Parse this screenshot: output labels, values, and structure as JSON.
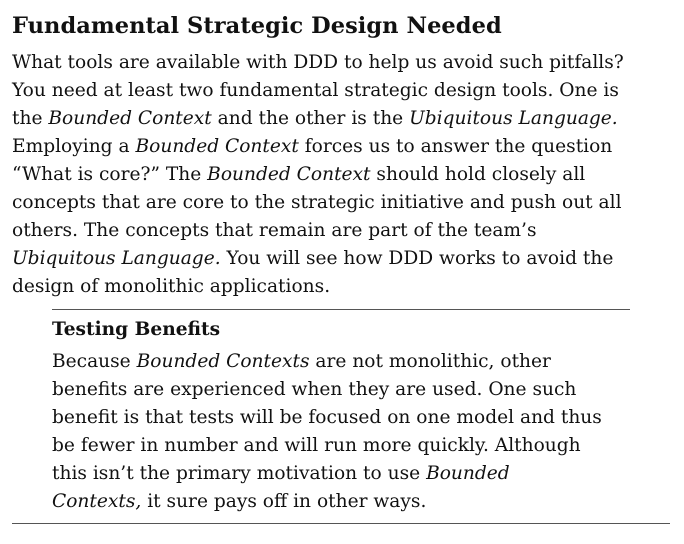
{
  "section": {
    "heading": "Fundamental Strategic Design Needed",
    "paragraph": {
      "l1": "What tools are available with DDD to help us avoid such pitfalls?",
      "l2": "You need at least two fundamental strategic design tools. One is",
      "l3_a": "the ",
      "l3_b": "Bounded Context",
      "l3_c": " and the other is the ",
      "l3_d": "Ubiquitous Language.",
      "l4_a": "Employing a ",
      "l4_b": "Bounded Context",
      "l4_c": " forces us to answer the question",
      "l5_a": "“What is core?” The ",
      "l5_b": "Bounded Context",
      "l5_c": " should hold closely all",
      "l6": "concepts that are core to the strategic initiative and push out all",
      "l7": "others. The concepts that remain are part of the team’s",
      "l8_a": "Ubiquitous Language.",
      "l8_b": " You will see how DDD works to avoid the",
      "l9": "design of monolithic applications."
    }
  },
  "sidebar": {
    "title": "Testing Benefits",
    "text": {
      "l1_a": "Because ",
      "l1_b": "Bounded Contexts",
      "l1_c": " are not monolithic, other",
      "l2": "benefits are experienced when they are used. One such",
      "l3": "benefit is that tests will be focused on one model and thus",
      "l4": "be fewer in number and will run more quickly. Although",
      "l5_a": "this isn’t the primary motivation to use ",
      "l5_b": "Bounded",
      "l6_a": "Contexts,",
      "l6_b": " it sure pays off in other ways."
    }
  }
}
